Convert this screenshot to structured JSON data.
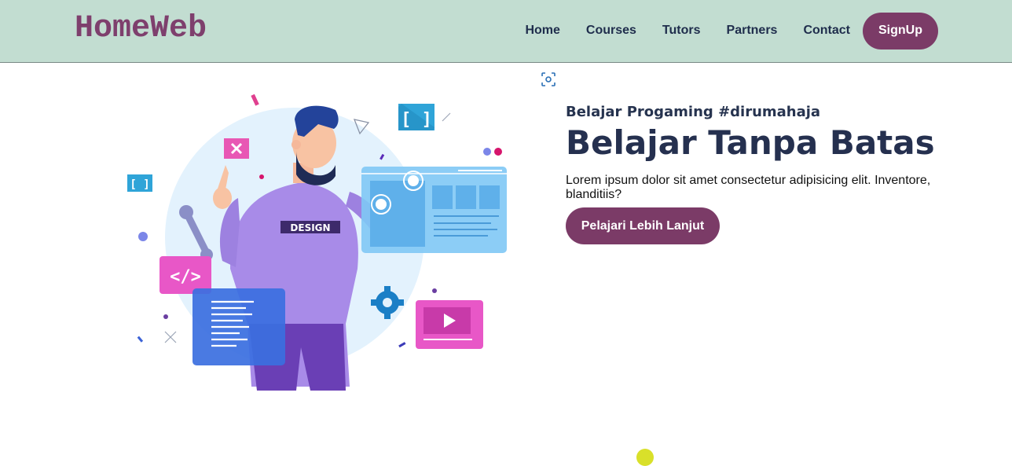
{
  "brand": {
    "name": "HomeWeb"
  },
  "nav": {
    "links": [
      "Home",
      "Courses",
      "Tutors",
      "Partners",
      "Contact"
    ],
    "signup_label": "SignUp"
  },
  "hero": {
    "subtitle": "Belajar Progaming #dirumahaja",
    "title": "Belajar Tanpa Batas",
    "description": "Lorem ipsum dolor sit amet consectetur adipisicing elit. Inventore, blanditiis?",
    "cta_label": "Pelajari Lebih Lanjut",
    "illustration": {
      "shirt_text": "DESIGN"
    }
  },
  "colors": {
    "navbar_bg": "#c2ddd1",
    "brand": "#7e3f6d",
    "button": "#7b3b67",
    "heading": "#25304f"
  }
}
